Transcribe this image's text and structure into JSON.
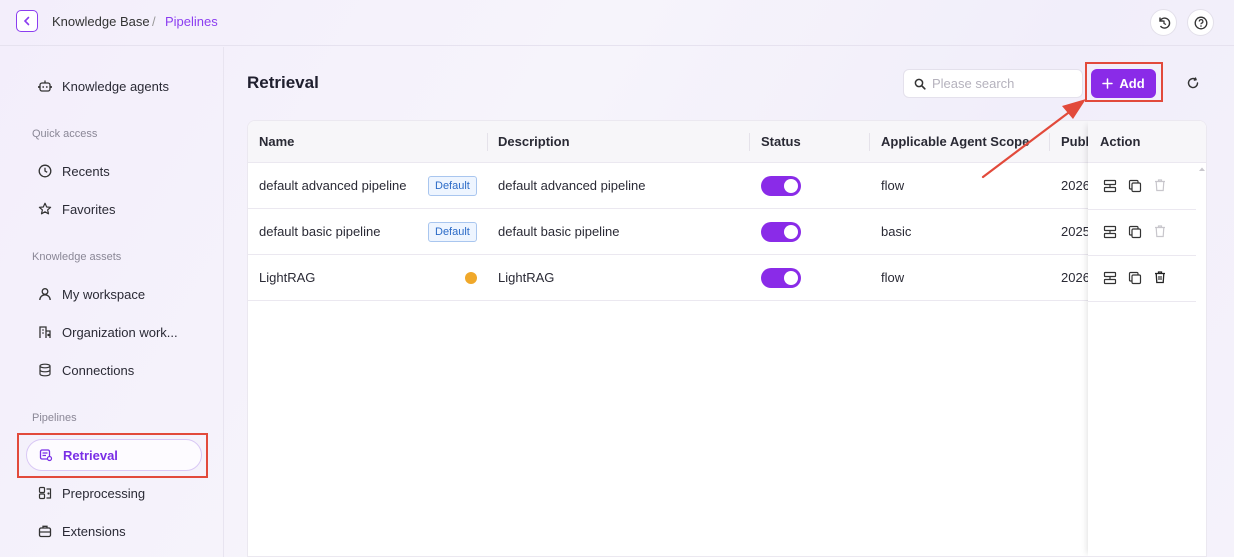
{
  "breadcrumb": {
    "root": "Knowledge Base",
    "separator": "/",
    "current": "Pipelines"
  },
  "sidebar": {
    "top_item": "Knowledge agents",
    "sections": [
      {
        "title": "Quick access",
        "items": [
          "Recents",
          "Favorites"
        ]
      },
      {
        "title": "Knowledge assets",
        "items": [
          "My workspace",
          "Organization work...",
          "Connections"
        ]
      },
      {
        "title": "Pipelines",
        "items": [
          "Retrieval",
          "Preprocessing",
          "Extensions"
        ]
      }
    ],
    "active": "Retrieval"
  },
  "main": {
    "title": "Retrieval",
    "search_placeholder": "Please search",
    "add_label": "Add"
  },
  "table": {
    "columns": [
      "Name",
      "Description",
      "Status",
      "Applicable Agent Scope",
      "Publi",
      "Action"
    ],
    "rows": [
      {
        "name": "default advanced pipeline",
        "badge": "Default",
        "description": "default advanced pipeline",
        "status": "on",
        "scope": "flow",
        "published": "2026",
        "delete_enabled": false
      },
      {
        "name": "default basic pipeline",
        "badge": "Default",
        "description": "default basic pipeline",
        "status": "on",
        "scope": "basic",
        "published": "2025",
        "delete_enabled": false
      },
      {
        "name": "LightRAG",
        "badge": "",
        "warning": true,
        "description": "LightRAG",
        "status": "on",
        "scope": "flow",
        "published": "2026",
        "delete_enabled": true
      }
    ]
  },
  "colors": {
    "accent": "#8a2be8",
    "highlight": "#e24a3b",
    "badge": "#2c6bc7",
    "warning": "#f0a82a"
  }
}
